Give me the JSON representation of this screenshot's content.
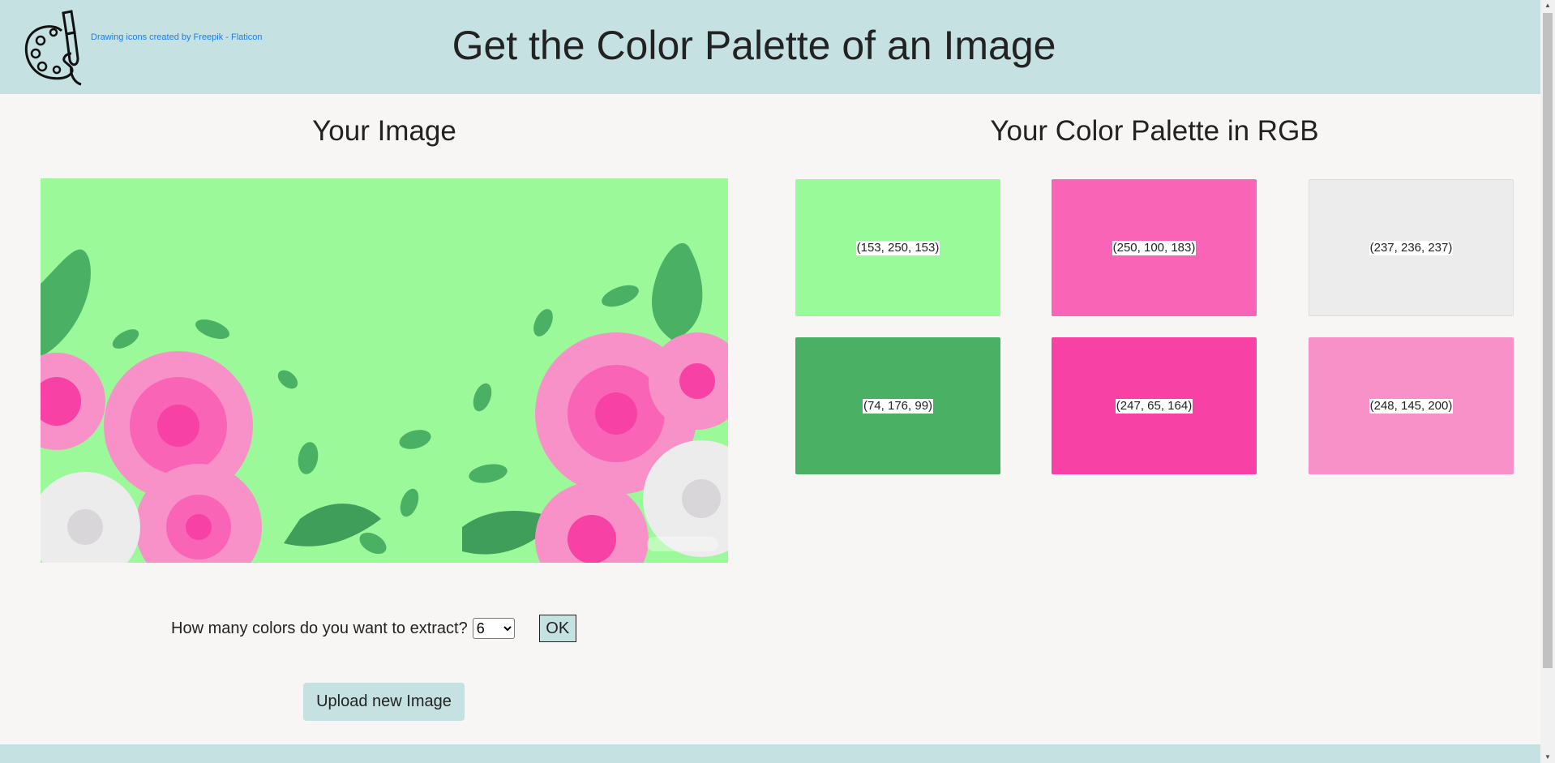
{
  "header": {
    "title": "Get the Color Palette of an Image",
    "credit": "Drawing icons created by Freepik - Flaticon",
    "logo_icon": "palette-brush-icon"
  },
  "image_section": {
    "title": "Your Image",
    "image_description_icon": "uploaded-image",
    "controls": {
      "question": "How many colors do you want to extract?",
      "selected_count": "6",
      "ok_label": "OK"
    },
    "upload_label": "Upload new Image"
  },
  "palette_section": {
    "title": "Your Color Palette in RGB",
    "swatches": [
      {
        "label": "(153, 250, 153)",
        "color": "#99fa99"
      },
      {
        "label": "(250, 100, 183)",
        "color": "#fa64b7"
      },
      {
        "label": "(237, 236, 237)",
        "color": "#edeced"
      },
      {
        "label": "(74, 176, 99)",
        "color": "#4ab063"
      },
      {
        "label": "(247, 65, 164)",
        "color": "#f741a4"
      },
      {
        "label": "(248, 145, 200)",
        "color": "#f891c8"
      }
    ]
  },
  "colors": {
    "header_bg": "#c5e1e2",
    "page_bg": "#f7f6f4",
    "link": "#1a7fe8"
  }
}
